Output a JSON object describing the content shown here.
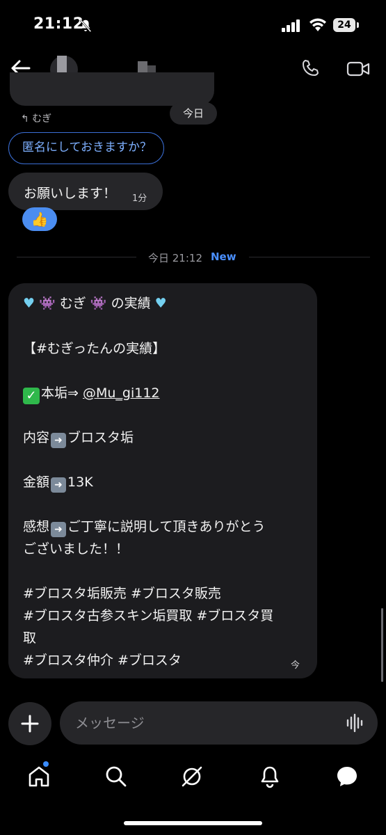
{
  "status_bar": {
    "time": "21:12",
    "battery": "24"
  },
  "chat": {
    "reply_label": "↰ むぎ",
    "today_chip": "今日",
    "reply_bubble_text": "匿名にしておきますか？",
    "message_text": "お願いします！",
    "message_time": "1分",
    "reaction": "👍",
    "divider_label": "今日 21:12",
    "divider_new": "New",
    "long_message": {
      "line1_text": "むぎ",
      "line1_suffix": "の実績",
      "line2": "【#むぎったんの実績】",
      "line3_prefix": "本垢⇒ ",
      "line3_link": "@Mu_gi112",
      "line4_label": "内容",
      "line4_value": "ブロスタ垢",
      "line5_label": "金額",
      "line5_value": "13K",
      "line6_label": "感想",
      "line6_value": "ご丁寧に説明して頂きありがとう",
      "line7": "ございました！！",
      "line8": "#ブロスタ垢販売  #ブロスタ販売",
      "line9": "#ブロスタ古参スキン垢買取  #ブロスタ買",
      "line10": "取",
      "line11": "#ブロスタ仲介 #ブロスタ",
      "time": "今"
    }
  },
  "composer": {
    "placeholder": "メッセージ"
  },
  "colors": {
    "background": "#000000",
    "bubble": "#262629",
    "accent": "#3b6fd6",
    "new_label": "#4a8fff"
  }
}
